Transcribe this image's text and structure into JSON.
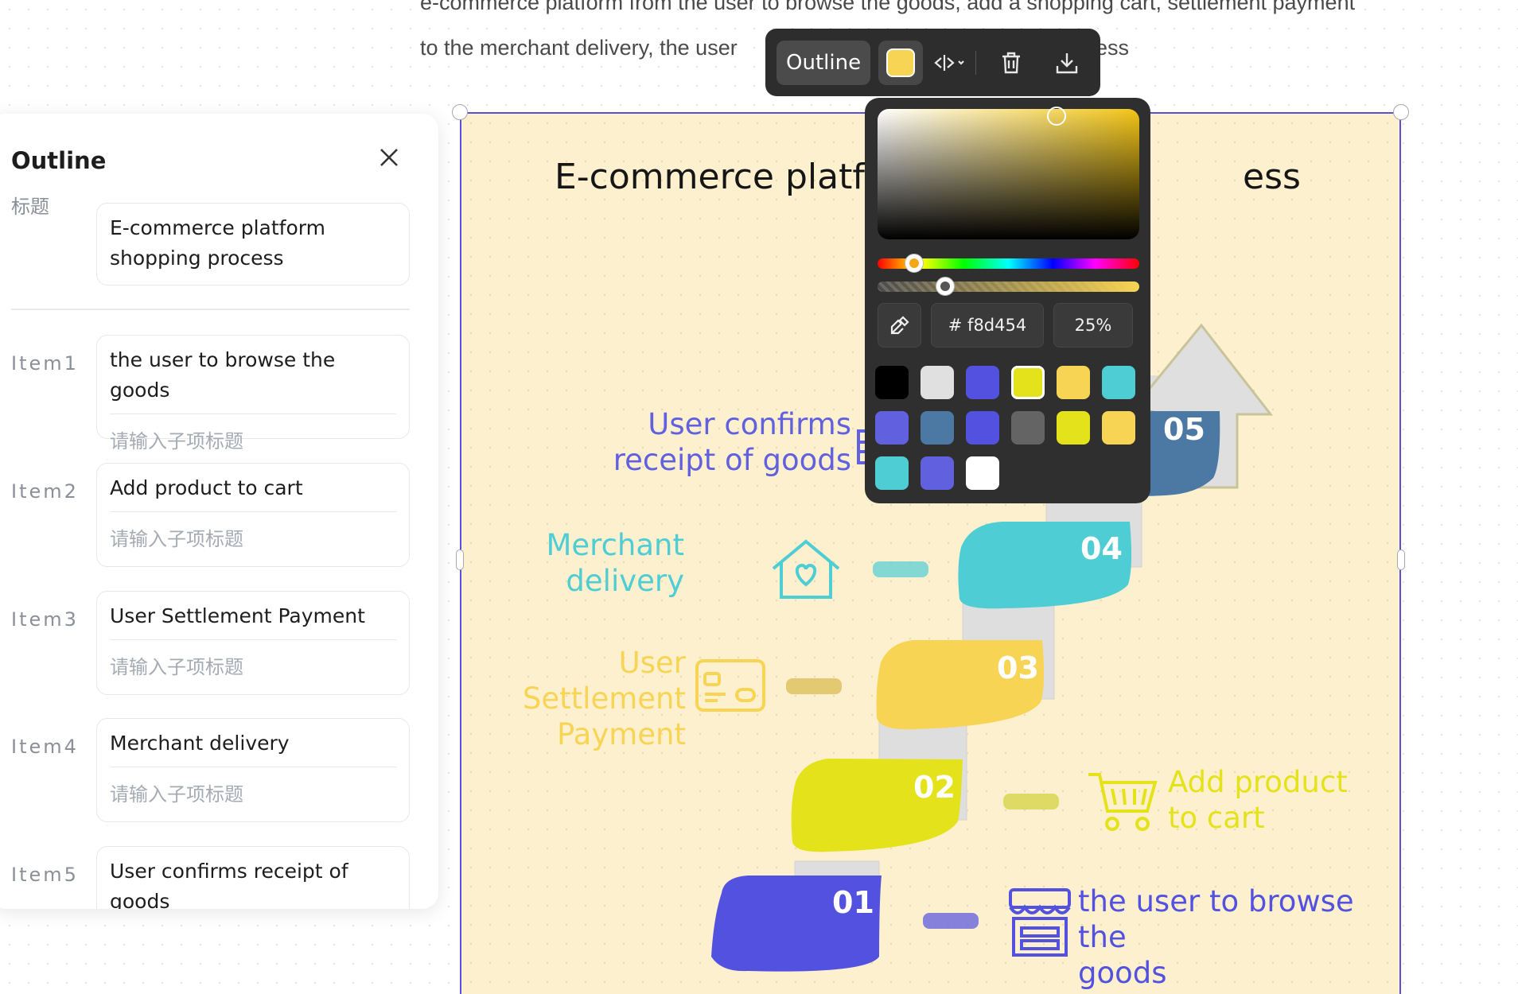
{
  "document": {
    "paragraph_line1": "e-commerce platform from the user to browse the goods, add a shopping cart, settlement payment",
    "paragraph_line2_start": "to the merchant delivery, the user",
    "paragraph_line2_end": "ess"
  },
  "infographic": {
    "title_visible_start": "E-commerce platform shopping process",
    "title_visible_end": "ess",
    "steps": [
      {
        "number": "01",
        "label": "the user to browse the goods",
        "color": "#5352e0",
        "icon": "store-icon"
      },
      {
        "number": "02",
        "label": "Add product to cart",
        "color": "#e4e21b",
        "icon": "shopping-cart-icon"
      },
      {
        "number": "03",
        "label": "User Settlement Payment",
        "color": "#f8d454",
        "icon": "credit-card-icon"
      },
      {
        "number": "04",
        "label": "Merchant delivery",
        "color": "#4fcdd5",
        "icon": "house-heart-icon"
      },
      {
        "number": "05",
        "label": "User confirms receipt of goods",
        "color": "#6161e0",
        "icon": "truck-icon"
      }
    ],
    "label_lines": {
      "step1": [
        "the user to browse the",
        "goods"
      ],
      "step2": [
        "Add product",
        "to cart"
      ],
      "step3": [
        "User",
        "Settlement",
        "Payment"
      ],
      "step4": [
        "Merchant",
        "delivery"
      ],
      "step5": [
        "User confirms",
        "receipt of goods"
      ]
    }
  },
  "toolbar": {
    "outline_label": "Outline",
    "current_color": "#f8d454",
    "icons": [
      "color-swatch-icon",
      "flip-icon",
      "chevron-down-icon",
      "trash-icon",
      "download-icon"
    ]
  },
  "color_picker": {
    "hex_value": "# f8d454",
    "alpha_value": "25%",
    "hue_fraction": 0.14,
    "alpha_fraction": 0.26,
    "swatches": [
      "#000000",
      "#e0e0e0",
      "#5352e0",
      "#e4e21b",
      "#f8d454",
      "#4fcdd5",
      "#6161e0",
      "#4b79a4",
      "#5352e0",
      "#646464",
      "#e4e21b",
      "#f8d454",
      "#4fcdd5",
      "#6161e0",
      "#ffffff"
    ],
    "selected_swatch_index": 3
  },
  "outline_panel": {
    "title": "Outline",
    "title_row_label": "标题",
    "title_value": "E-commerce platform shopping process",
    "items": [
      {
        "label": "Item1",
        "value": "the user to browse the goods",
        "sub_placeholder": "请输入子项标题"
      },
      {
        "label": "Item2",
        "value": "Add product to cart",
        "sub_placeholder": "请输入子项标题"
      },
      {
        "label": "Item3",
        "value": "User Settlement Payment",
        "sub_placeholder": "请输入子项标题"
      },
      {
        "label": "Item4",
        "value": "Merchant delivery",
        "sub_placeholder": "请输入子项标题"
      },
      {
        "label": "Item5",
        "value": "User confirms receipt of goods",
        "sub_placeholder": ""
      }
    ]
  }
}
